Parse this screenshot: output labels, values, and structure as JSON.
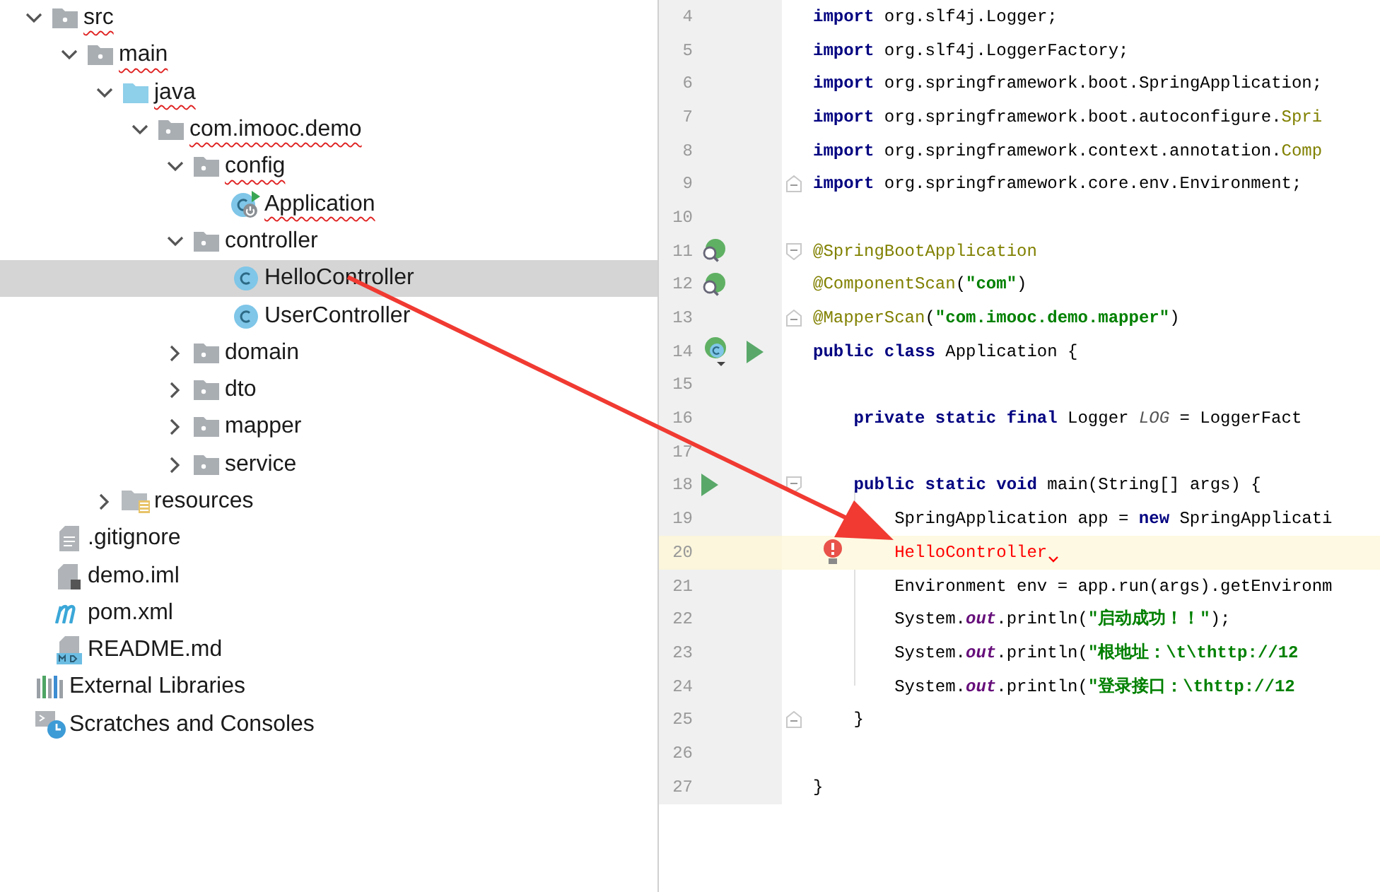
{
  "project_tree": {
    "items": [
      {
        "label": "src",
        "kind": "folder",
        "expanded": true,
        "selected": false,
        "spell_error": true,
        "children": [
          {
            "label": "main",
            "kind": "folder",
            "expanded": true,
            "selected": false,
            "spell_error": true,
            "children": [
              {
                "label": "java",
                "kind": "source-folder",
                "expanded": true,
                "selected": false,
                "spell_error": true,
                "children": [
                  {
                    "label": "com.imooc.demo",
                    "kind": "package",
                    "expanded": true,
                    "selected": false,
                    "spell_error": true,
                    "children": [
                      {
                        "label": "config",
                        "kind": "package",
                        "expanded": true,
                        "selected": false,
                        "spell_error": true,
                        "children": [
                          {
                            "label": "Application",
                            "kind": "spring-class",
                            "selected": false,
                            "spell_error": true
                          }
                        ]
                      },
                      {
                        "label": "controller",
                        "kind": "package",
                        "expanded": true,
                        "selected": false,
                        "spell_error": false,
                        "children": [
                          {
                            "label": "HelloController",
                            "kind": "class",
                            "selected": true,
                            "spell_error": false
                          },
                          {
                            "label": "UserController",
                            "kind": "class",
                            "selected": false,
                            "spell_error": false
                          }
                        ]
                      },
                      {
                        "label": "domain",
                        "kind": "package",
                        "expanded": false,
                        "selected": false,
                        "spell_error": false
                      },
                      {
                        "label": "dto",
                        "kind": "package",
                        "expanded": false,
                        "selected": false,
                        "spell_error": false
                      },
                      {
                        "label": "mapper",
                        "kind": "package",
                        "expanded": false,
                        "selected": false,
                        "spell_error": false
                      },
                      {
                        "label": "service",
                        "kind": "package",
                        "expanded": false,
                        "selected": false,
                        "spell_error": false
                      }
                    ]
                  }
                ]
              },
              {
                "label": "resources",
                "kind": "resources-folder",
                "expanded": false,
                "selected": false,
                "spell_error": false
              }
            ]
          }
        ]
      },
      {
        "label": ".gitignore",
        "kind": "text-file",
        "selected": false,
        "spell_error": false
      },
      {
        "label": "demo.iml",
        "kind": "iml-file",
        "selected": false,
        "spell_error": false
      },
      {
        "label": "pom.xml",
        "kind": "maven-file",
        "selected": false,
        "spell_error": false
      },
      {
        "label": "README.md",
        "kind": "markdown-file",
        "selected": false,
        "spell_error": false
      }
    ],
    "root_items": [
      {
        "label": "External Libraries",
        "kind": "libraries",
        "selected": false,
        "spell_error": false
      },
      {
        "label": "Scratches and Consoles",
        "kind": "scratches",
        "selected": false,
        "spell_error": false
      }
    ]
  },
  "editor": {
    "lines": [
      {
        "number": "4",
        "current": false,
        "segments": [
          {
            "kind": "keyword",
            "text": "import"
          },
          {
            "kind": "plain",
            "text": " org.slf4j.Logger;"
          }
        ]
      },
      {
        "number": "5",
        "current": false,
        "segments": [
          {
            "kind": "keyword",
            "text": "import"
          },
          {
            "kind": "plain",
            "text": " org.slf4j.LoggerFactory;"
          }
        ]
      },
      {
        "number": "6",
        "current": false,
        "segments": [
          {
            "kind": "keyword",
            "text": "import"
          },
          {
            "kind": "plain",
            "text": " org.springframework.boot.SpringApplication;"
          }
        ]
      },
      {
        "number": "7",
        "current": false,
        "segments": [
          {
            "kind": "keyword",
            "text": "import"
          },
          {
            "kind": "plain",
            "text": " org.springframework.boot.autoconfigure."
          },
          {
            "kind": "annotation",
            "text": "Spri"
          }
        ]
      },
      {
        "number": "8",
        "current": false,
        "segments": [
          {
            "kind": "keyword",
            "text": "import"
          },
          {
            "kind": "plain",
            "text": " org.springframework.context.annotation."
          },
          {
            "kind": "annotation",
            "text": "Comp"
          }
        ]
      },
      {
        "number": "9",
        "current": false,
        "fold": {
          "kind": "end"
        },
        "segments": [
          {
            "kind": "keyword",
            "text": "import"
          },
          {
            "kind": "plain",
            "text": " org.springframework.core.env.Environment;"
          }
        ]
      },
      {
        "number": "10",
        "current": false
      },
      {
        "number": "11",
        "current": false,
        "fold": {
          "kind": "start"
        },
        "gutter": [
          {
            "kind": "bean"
          }
        ],
        "segments": [
          {
            "kind": "annotation",
            "text": "@SpringBootApplication"
          }
        ]
      },
      {
        "number": "12",
        "current": false,
        "gutter": [
          {
            "kind": "bean"
          }
        ],
        "segments": [
          {
            "kind": "annotation",
            "text": "@ComponentScan"
          },
          {
            "kind": "plain",
            "text": "("
          },
          {
            "kind": "string",
            "text": "\"com\""
          },
          {
            "kind": "plain",
            "text": ")"
          }
        ]
      },
      {
        "number": "13",
        "current": false,
        "fold": {
          "kind": "end"
        },
        "segments": [
          {
            "kind": "annotation",
            "text": "@MapperScan"
          },
          {
            "kind": "plain",
            "text": "("
          },
          {
            "kind": "string",
            "text": "\"com.imooc.demo.mapper\""
          },
          {
            "kind": "plain",
            "text": ")"
          }
        ]
      },
      {
        "number": "14",
        "current": false,
        "gutter": [
          {
            "kind": "bean-class"
          },
          {
            "kind": "run"
          }
        ],
        "segments": [
          {
            "kind": "keyword",
            "text": "public class"
          },
          {
            "kind": "plain",
            "text": " Application {"
          }
        ]
      },
      {
        "number": "15",
        "current": false
      },
      {
        "number": "16",
        "current": false,
        "segments": [
          {
            "kind": "keyword",
            "text": "    private static final"
          },
          {
            "kind": "plain",
            "text": " Logger "
          },
          {
            "kind": "constant",
            "text": "LOG"
          },
          {
            "kind": "plain",
            "text": " = LoggerFact"
          }
        ]
      },
      {
        "number": "17",
        "current": false
      },
      {
        "number": "18",
        "current": false,
        "fold": {
          "kind": "start"
        },
        "gutter": [
          {
            "kind": "run"
          }
        ],
        "segments": [
          {
            "kind": "keyword",
            "text": "    public static void"
          },
          {
            "kind": "plain",
            "text": " main(String[] args) {"
          }
        ]
      },
      {
        "number": "19",
        "current": false,
        "segments": [
          {
            "kind": "plain",
            "text": "        SpringApplication app = "
          },
          {
            "kind": "keyword",
            "text": "new"
          },
          {
            "kind": "plain",
            "text": " SpringApplicati"
          }
        ]
      },
      {
        "number": "20",
        "current": true,
        "error_bulb": true,
        "segments": [
          {
            "kind": "error",
            "text": "        HelloController"
          }
        ]
      },
      {
        "number": "21",
        "current": false,
        "segments": [
          {
            "kind": "plain",
            "text": "        Environment env = app.run(args).getEnvironm"
          }
        ]
      },
      {
        "number": "22",
        "current": false,
        "segments": [
          {
            "kind": "plain",
            "text": "        System."
          },
          {
            "kind": "field",
            "text": "out"
          },
          {
            "kind": "plain",
            "text": ".println("
          },
          {
            "kind": "string",
            "text": "\"启动成功！！\""
          },
          {
            "kind": "plain",
            "text": ");"
          }
        ]
      },
      {
        "number": "23",
        "current": false,
        "segments": [
          {
            "kind": "plain",
            "text": "        System."
          },
          {
            "kind": "field",
            "text": "out"
          },
          {
            "kind": "plain",
            "text": ".println("
          },
          {
            "kind": "string",
            "text": "\"根地址：\\t\\thttp://12"
          }
        ]
      },
      {
        "number": "24",
        "current": false,
        "segments": [
          {
            "kind": "plain",
            "text": "        System."
          },
          {
            "kind": "field",
            "text": "out"
          },
          {
            "kind": "plain",
            "text": ".println("
          },
          {
            "kind": "string",
            "text": "\"登录接口：\\thttp://12"
          }
        ]
      },
      {
        "number": "25",
        "current": false,
        "fold": {
          "kind": "end"
        },
        "segments": [
          {
            "kind": "plain",
            "text": "    }"
          }
        ]
      },
      {
        "number": "26",
        "current": false
      },
      {
        "number": "27",
        "current": false,
        "segments": [
          {
            "kind": "plain",
            "text": "}"
          }
        ]
      }
    ]
  }
}
